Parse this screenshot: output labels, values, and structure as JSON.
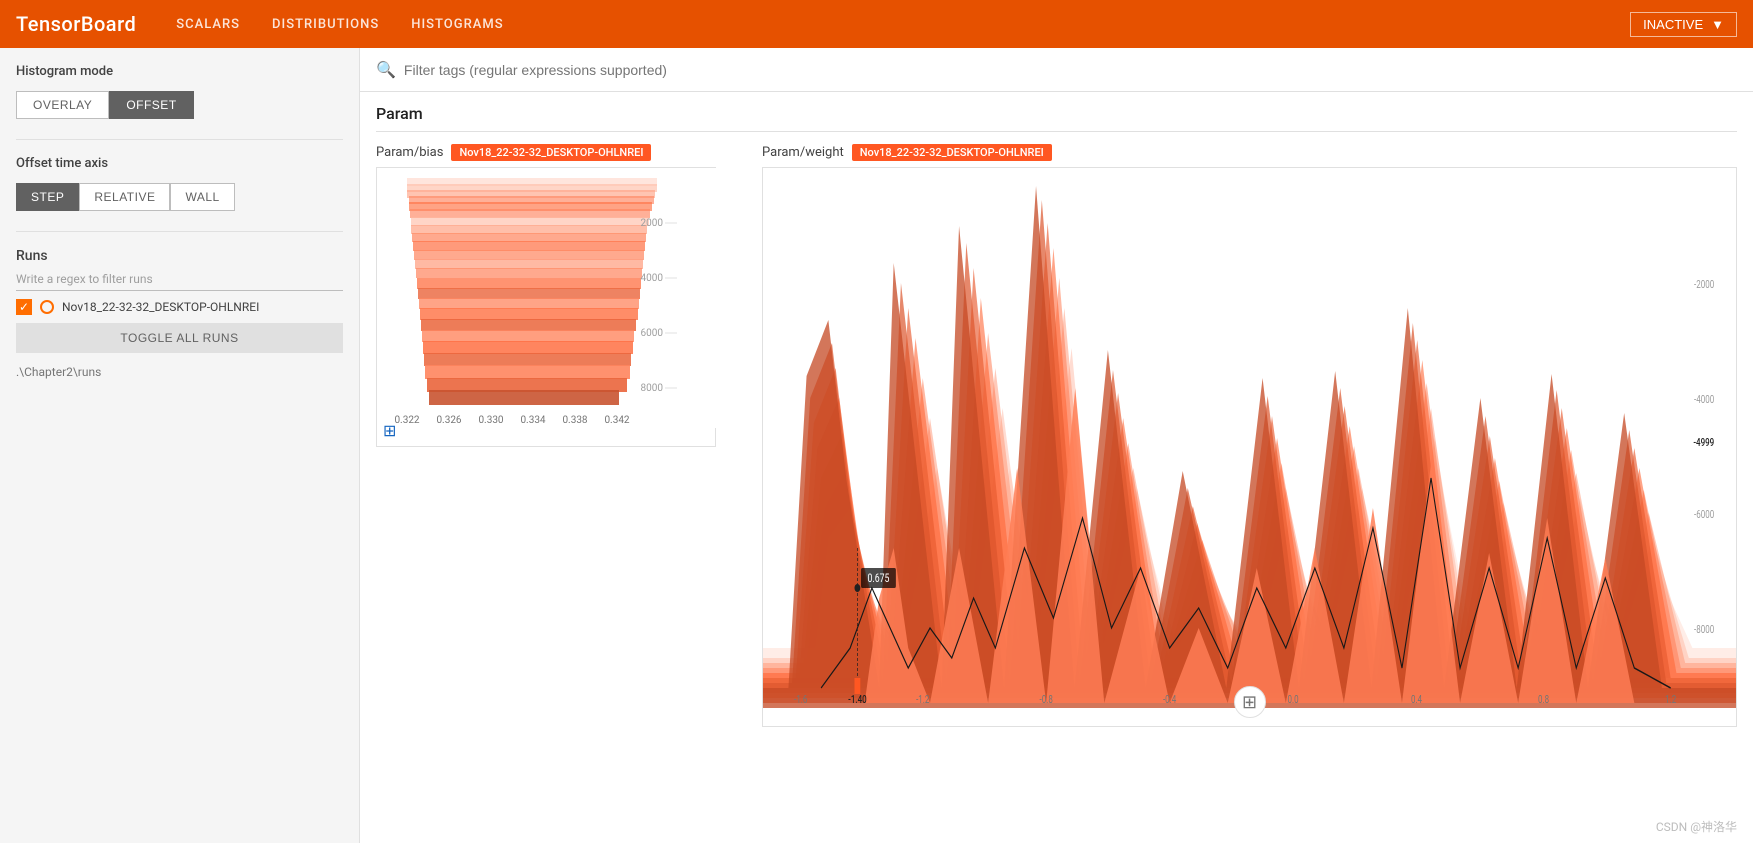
{
  "header": {
    "logo": "TensorBoard",
    "nav": [
      {
        "label": "SCALARS",
        "id": "scalars"
      },
      {
        "label": "DISTRIBUTIONS",
        "id": "distributions"
      },
      {
        "label": "HISTOGRAMS",
        "id": "histograms"
      }
    ],
    "status": "INACTIVE"
  },
  "search": {
    "placeholder": "Filter tags (regular expressions supported)"
  },
  "sidebar": {
    "histogram_mode_label": "Histogram mode",
    "mode_buttons": [
      {
        "label": "OVERLAY",
        "active": false
      },
      {
        "label": "OFFSET",
        "active": true
      }
    ],
    "offset_time_label": "Offset time axis",
    "time_buttons": [
      {
        "label": "STEP",
        "active": true
      },
      {
        "label": "RELATIVE",
        "active": false
      },
      {
        "label": "WALL",
        "active": false
      }
    ],
    "runs_label": "Runs",
    "runs_filter_placeholder": "Write a regex to filter runs",
    "run_name": "Nov18_22-32-32_DESKTOP-OHLNREI",
    "toggle_all_label": "TOGGLE ALL RUNS",
    "data_path": ".\\Chapter2\\runs"
  },
  "content": {
    "section_title": "Param",
    "charts": [
      {
        "id": "param-bias",
        "title": "Param/bias",
        "run_badge": "Nov18_22-32-32_DESKTOP-OHLNREI",
        "x_labels": [
          "0.322",
          "0.326",
          "0.330",
          "0.334",
          "0.338",
          "0.342"
        ],
        "y_labels": [
          "2000",
          "4000",
          "6000",
          "8000"
        ],
        "size": "small"
      },
      {
        "id": "param-weight",
        "title": "Param/weight",
        "run_badge": "Nov18_22-32-32_DESKTOP-OHLNREI",
        "x_labels": [
          "-1.6",
          "-1.40",
          "-1.2",
          "-0.8",
          "-0.4",
          "0.0",
          "0.4",
          "0.8",
          "1.2"
        ],
        "y_labels": [
          "-2000",
          "-4000",
          "-4999",
          "-6000",
          "-8000"
        ],
        "tooltip_value": "0.675",
        "tooltip_x": "-1.40",
        "size": "large"
      }
    ]
  },
  "watermark": "CSDN @神洛华",
  "colors": {
    "orange_primary": "#E65100",
    "orange_accent": "#FF5722",
    "histogram_fill": "#FF7043",
    "histogram_fill_light": "#FFCCBC"
  }
}
